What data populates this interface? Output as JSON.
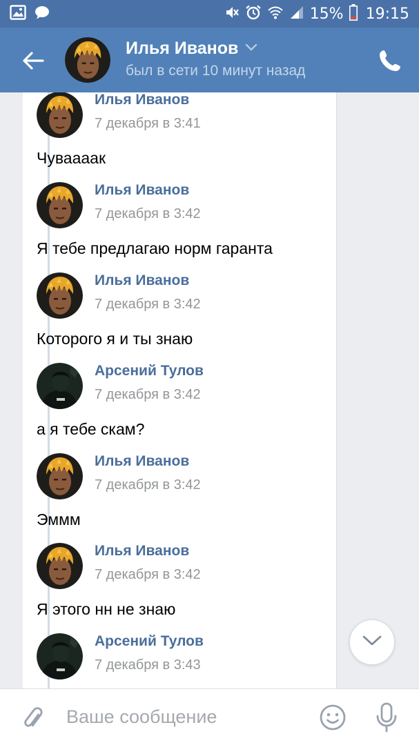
{
  "status_bar": {
    "battery": "15%",
    "time": "19:15",
    "icons": [
      "image-icon",
      "message-icon",
      "mute-icon",
      "alarm-icon",
      "wifi-icon",
      "signal-icon",
      "battery-icon"
    ]
  },
  "header": {
    "name": "Илья Иванов",
    "status": "был в сети 10 минут назад",
    "icons": [
      "back-arrow-icon",
      "chevron-down-icon",
      "phone-icon"
    ]
  },
  "messages": [
    {
      "sender": "Илья Иванов",
      "time": "7 декабря в 3:41",
      "text": "Чуваааак",
      "avatar": "ilya"
    },
    {
      "sender": "Илья Иванов",
      "time": "7 декабря в 3:42",
      "text": "Я тебе предлагаю норм гаранта",
      "avatar": "ilya"
    },
    {
      "sender": "Илья Иванов",
      "time": "7 декабря в 3:42",
      "text": "Которого я и ты знаю",
      "avatar": "ilya"
    },
    {
      "sender": "Арсений Тулов",
      "time": "7 декабря в 3:42",
      "text": "а я тебе скам?",
      "avatar": "arseniy"
    },
    {
      "sender": "Илья Иванов",
      "time": "7 декабря в 3:42",
      "text": "Эммм",
      "avatar": "ilya"
    },
    {
      "sender": "Илья Иванов",
      "time": "7 декабря в 3:42",
      "text": "Я этого нн не знаю",
      "avatar": "ilya"
    },
    {
      "sender": "Арсений Тулов",
      "time": "7 декабря в 3:43",
      "text": "",
      "avatar": "arseniy"
    }
  ],
  "composer": {
    "placeholder": "Ваше сообщение",
    "value": "",
    "icons": [
      "paperclip-icon",
      "emoji-icon",
      "microphone-icon"
    ]
  },
  "scroll_down": {
    "icon": "chevron-down-icon"
  },
  "colors": {
    "status_bar": "#4a72a8",
    "header": "#5181b8",
    "sender_name": "#4a6e9b",
    "timestamp": "#939699",
    "background": "#ebedf0"
  }
}
